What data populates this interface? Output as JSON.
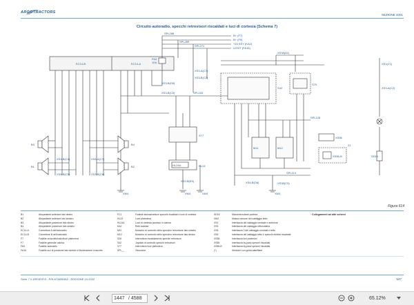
{
  "header": {
    "logo": "ARGOTRACTORS",
    "section": "SEZIONE 4001"
  },
  "title": "Circuito autoradio, specchi retrovisori riscaldati e luci di cortesia (Schema 7)",
  "diagram": {
    "labels": {
      "ec14b": "EC14-B",
      "ec14a": "EC14-A",
      "spl288": "SPL288",
      "spl289": "SPL289",
      "spl271": "SPL271",
      "fa3": "FA3",
      "amp": "10A",
      "fa16": "FA16",
      "bplus": "B+ (F7)",
      "bplus2": "B+ (F9)",
      "key": "+15 KEY (KA2)",
      "light": "LIGHT (FA16)",
      "xs3b5": "XS3-B(D5)",
      "xs3b4": "XS3-B(C5)",
      "xs3a": "XS3-A(C7)",
      "xs3b": "XS3-B(C2)",
      "spl153": "SPL153",
      "s42": "S42",
      "s77": "S77",
      "s79": "S79",
      "sd16": "SD16",
      "spl128": "SPL128",
      "spl114": "SPL114",
      "m11": "M11",
      "m12": "M12",
      "hl24": "HL24",
      "hl24a": "HL24A",
      "xs56": "XS56",
      "xs56b": "XS56-B",
      "b3": "B3",
      "b4": "B4",
      "b1": "B1",
      "b2": "B2",
      "xs3bc4": "XS3-B(C4)",
      "xs5bc5": "XS5-B(C5)",
      "xs5ac7": "XS5-A(C7)",
      "xs3bc6": "XS3-B(C6)",
      "xs3be5": "XS3-B(E5)",
      "xs6bd6": "XS6-B(D6)",
      "xs1": "XS1(C1)",
      "xs3a2": "XS3-A(C2)",
      "xs38": "XS38(A1)",
      "xs38b": "XS38(C3)",
      "xm4": "XM4",
      "tag21": "21"
    }
  },
  "figure": "Figura 614",
  "legend": {
    "col1": [
      [
        "B1",
        "Altoparlante anteriore lato destro"
      ],
      [
        "B2",
        "Altoparlante anteriore lato sinistro"
      ],
      [
        "B3",
        "Altoparlante posteriore lato destro"
      ],
      [
        "B4",
        "Altoparlante posteriore lato sinistro"
      ],
      [
        "EC14-A",
        "Connettore A dell'autoradio"
      ],
      [
        "EC14-B",
        "Connettore B dell'autoradio"
      ],
      [
        "F7",
        "Fusibile cruscotto/radio/luce plafoniera"
      ],
      [
        "F7",
        "Fusibile generale cabina"
      ],
      [
        "FA3",
        "Fusibile autoradio"
      ],
      [
        "FA16",
        "Fusibile luci di posizione lato sinistro e illuminazione cruscotto"
      ]
    ],
    "col2": [
      [
        "FC1",
        "Fusibile sbrinatore/luce specchi riscaldati e luce di cortesia"
      ],
      [
        "HL24",
        "Luce plafoniera"
      ],
      [
        "HL24A",
        "Luce di cortesia accesso in cabina"
      ],
      [
        "KA2",
        "Relè ausiliari"
      ],
      [
        "M11",
        "Motorino di controllo dello specchio retrovisore lato sinistro"
      ],
      [
        "M12",
        "Motorino di controllo dello specchio retrovisore lato destro"
      ],
      [
        "S26",
        "Interruttore riscaldamento specchi retrovisori"
      ],
      [
        "S42",
        "Joystick di controllo specchi retrovisori"
      ],
      [
        "S77",
        "Interruttore luce plafoniera"
      ],
      [
        "SPL__",
        "Giunzione"
      ]
    ],
    "col3": [
      [
        "SD16",
        "Microinterruttore portiera"
      ],
      [
        "XM4",
        "Massa comune del cablaggio tetto"
      ],
      [
        "XS1",
        "Interfaccia del cablaggio centrale e anteriore"
      ],
      [
        "XS3",
        "Interfaccia del cablaggio tetto/cabina"
      ],
      [
        "XS5",
        "Interfaccia 2 del cablaggio centrale e tetto"
      ],
      [
        "XS6",
        "Interfaccia del cablaggio tetto e specchi elettrici riscaldati"
      ],
      [
        "XS38",
        "Interfaccia luci posteriori"
      ],
      [
        "XS56",
        "Interfaccia by-pass specchi riscaldati"
      ],
      [
        "XS56-B",
        "Interfaccia by-pass specchi riscaldati"
      ],
      [
        "(*)",
        "Versione con guida satellitare"
      ]
    ],
    "col4_head": "Collegamenti ad altri schemi"
  },
  "footer": {
    "left": "Serie 7 V-DRIVE/FIS - P/N 6726853A2 - EDIZIONE 10-2022",
    "right": "547"
  },
  "viewer": {
    "page_current": "1447",
    "page_total": "/ 4588",
    "zoom": "65.12%"
  }
}
